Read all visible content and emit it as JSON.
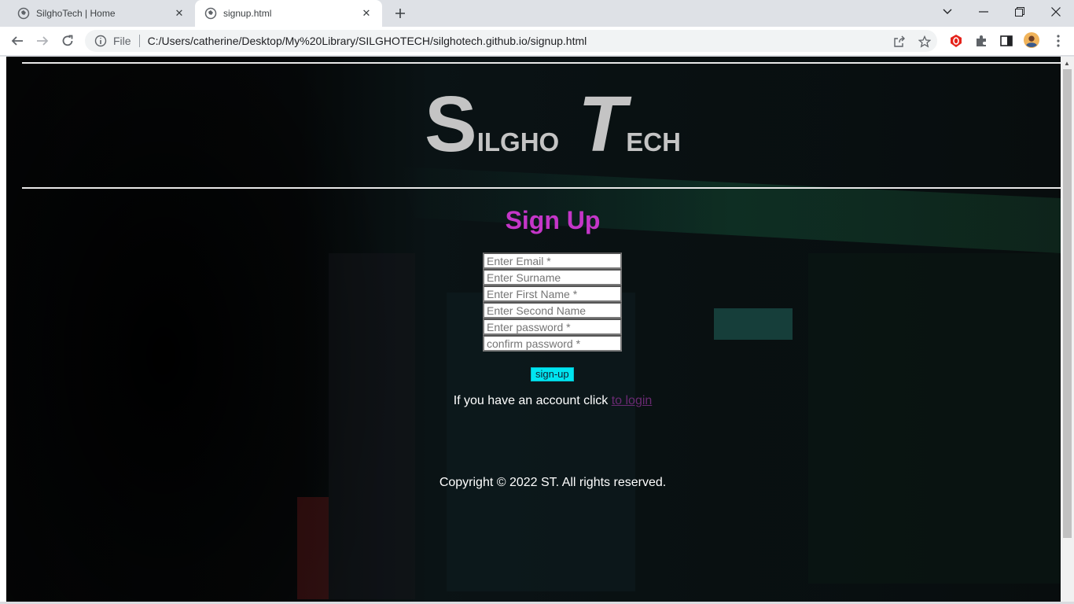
{
  "browser": {
    "tabs": [
      {
        "title": "SilghoTech | Home",
        "active": false
      },
      {
        "title": "signup.html",
        "active": true
      }
    ],
    "address_bar": {
      "scheme_label": "File",
      "url": "C:/Users/catherine/Desktop/My%20Library/SILGHOTECH/silghotech.github.io/signup.html"
    },
    "accent_colors": {
      "adblock": "#e5231b"
    }
  },
  "page": {
    "logo": {
      "s": "S",
      "ilgho": "ILGHO",
      "t": "T",
      "ech": "ECH"
    },
    "heading": "Sign Up",
    "form": {
      "email_placeholder": "Enter Email *",
      "surname_placeholder": "Enter Surname",
      "first_name_placeholder": "Enter First Name *",
      "second_name_placeholder": "Enter Second Name",
      "password_placeholder": "Enter password *",
      "confirm_password_placeholder": "confirm password *",
      "submit_label": "sign-up"
    },
    "account_text": "If you have an account click",
    "login_link": "to login",
    "copyright": "Copyright © 2022 ST. All rights reserved.",
    "colors": {
      "heading": "#c436c8",
      "submit_bg": "#00e5f0",
      "link": "#6a2a72"
    }
  }
}
